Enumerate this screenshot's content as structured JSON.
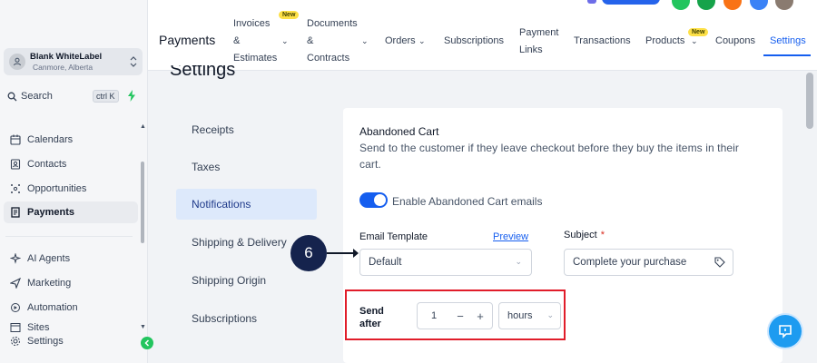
{
  "sidebar": {
    "location_name": "Blank WhiteLabel",
    "location_sub": "Canmore, Alberta",
    "search_label": "Search",
    "search_shortcut": "ctrl K",
    "items": [
      {
        "label": "Calendars",
        "icon": "calendar-icon"
      },
      {
        "label": "Contacts",
        "icon": "contacts-icon"
      },
      {
        "label": "Opportunities",
        "icon": "opportunities-icon"
      },
      {
        "label": "Payments",
        "icon": "payments-icon",
        "active": true
      },
      {
        "label": "AI Agents",
        "icon": "ai-agents-icon"
      },
      {
        "label": "Marketing",
        "icon": "marketing-icon"
      },
      {
        "label": "Automation",
        "icon": "automation-icon"
      },
      {
        "label": "Sites",
        "icon": "sites-icon"
      },
      {
        "label": "Settings",
        "icon": "settings-icon"
      }
    ]
  },
  "topbar": {
    "title": "Payments",
    "tabs": {
      "invoices_1": "Invoices",
      "invoices_2": "&",
      "invoices_3": "Estimates",
      "documents_1": "Documents",
      "documents_2": "&",
      "documents_3": "Contracts",
      "orders": "Orders",
      "subscriptions": "Subscriptions",
      "payment_links_1": "Payment",
      "payment_links_2": "Links",
      "transactions": "Transactions",
      "products": "Products",
      "coupons": "Coupons",
      "settings": "Settings"
    },
    "new_badge": "New",
    "accent": "#155eef"
  },
  "page": {
    "title": "Settings",
    "subnav": [
      "Receipts",
      "Taxes",
      "Notifications",
      "Shipping & Delivery",
      "Shipping Origin",
      "Subscriptions"
    ],
    "active_subnav": "Notifications"
  },
  "card": {
    "title": "Abandoned Cart",
    "description": "Send to the customer if they leave checkout before they buy the items in their cart.",
    "toggle_label": "Enable Abandoned Cart emails",
    "toggle_on": true,
    "email_template_label": "Email Template",
    "preview_label": "Preview",
    "email_template_value": "Default",
    "subject_label": "Subject",
    "subject_required": "*",
    "subject_value": "Complete your purchase",
    "send_after_label_1": "Send",
    "send_after_label_2": "after",
    "send_after_value": "1",
    "send_after_minus": "−",
    "send_after_plus": "+",
    "send_after_unit": "hours"
  },
  "annotation": {
    "step_number": "6",
    "highlight_color": "#e11d2a"
  }
}
